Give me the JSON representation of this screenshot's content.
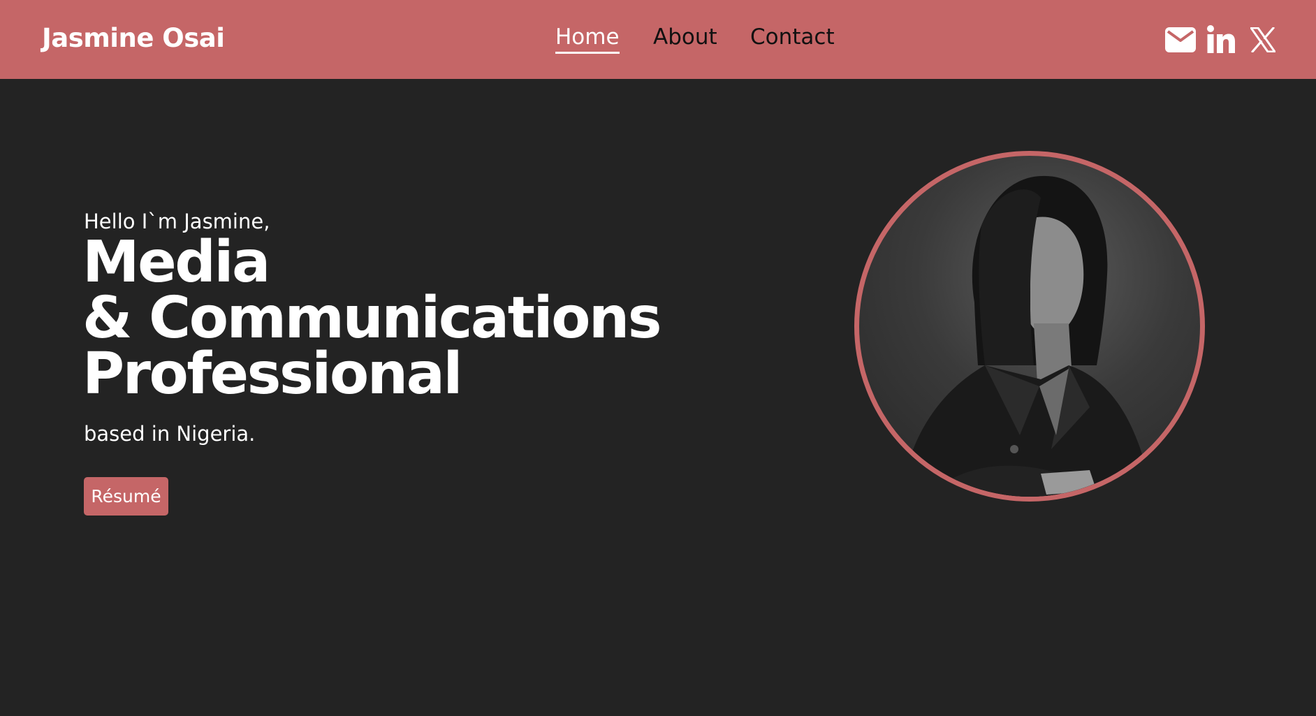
{
  "colors": {
    "accent": "#c56667",
    "background": "#232323",
    "text_light": "#ffffff",
    "nav_text": "#111111"
  },
  "header": {
    "brand": "Jasmine Osai",
    "nav": [
      {
        "label": "Home",
        "active": true
      },
      {
        "label": "About",
        "active": false
      },
      {
        "label": "Contact",
        "active": false
      }
    ],
    "social_icons": [
      "mail-icon",
      "linkedin-icon",
      "x-icon"
    ]
  },
  "hero": {
    "greeting": "Hello I`m Jasmine,",
    "headline": [
      "Media",
      "& Communications",
      "Professional"
    ],
    "tagline": "based in Nigeria.",
    "resume_label": "Résumé"
  }
}
